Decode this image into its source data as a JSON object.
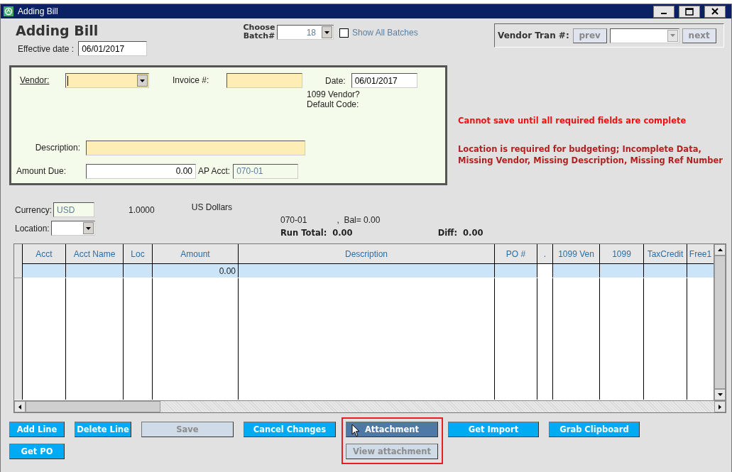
{
  "window": {
    "title": "Adding Bill"
  },
  "heading": "Adding Bill",
  "batch": {
    "label": "Choose Batch#",
    "value": "18",
    "show_all": {
      "label": "Show All Batches",
      "checked": false
    }
  },
  "vendor_tran": {
    "label": "Vendor Tran #:",
    "prev": {
      "label": "prev",
      "disabled": true
    },
    "next": {
      "label": "next",
      "disabled": true
    }
  },
  "effective_date": {
    "label": "Effective date :",
    "value": "06/01/2017"
  },
  "bill": {
    "vendor": {
      "label": "Vendor:",
      "required": true
    },
    "invoice": {
      "label": "Invoice #:",
      "required": true
    },
    "date": {
      "label": "Date:",
      "value": "06/01/2017"
    },
    "vendor_1099": "1099 Vendor?",
    "default_code": "Default Code:",
    "description": {
      "label": "Description:",
      "required": true
    },
    "amount_due": {
      "label": "Amount Due:",
      "value": "0.00"
    },
    "ap_acct": {
      "label": "AP Acct:",
      "value": "070-01",
      "disabled": true
    }
  },
  "messages": [
    {
      "kind": "error",
      "text": "Cannot save until all required fields are complete"
    },
    {
      "kind": "warning",
      "text": "Location is required for budgeting; Incomplete Data,\nMissing Vendor, Missing Description, Missing Ref Number"
    }
  ],
  "currency": {
    "label": "Currency:",
    "code": "USD",
    "rate": "1.0000",
    "name": "US Dollars"
  },
  "location": {
    "label": "Location:"
  },
  "summary": {
    "account": "070-01",
    "balance": ",  Bal= 0.00",
    "run_total_label": "Run Total:",
    "run_total": "0.00",
    "diff_label": "Diff:",
    "diff": "0.00"
  },
  "grid": {
    "columns": [
      "Acct",
      "Acct Name",
      "Loc",
      "Amount",
      "Description",
      "PO #",
      ".",
      "1099 Ven",
      "1099",
      "TaxCredit",
      "Free1"
    ],
    "rows": [
      {
        "selected": true,
        "amount": "0.00"
      }
    ]
  },
  "button_columns": [
    {
      "highlighted": false,
      "buttons": [
        {
          "label": "Add Line",
          "disabled": false,
          "hovered": false
        },
        {
          "label": "Get PO",
          "disabled": false,
          "hovered": false
        }
      ]
    },
    {
      "highlighted": false,
      "buttons": [
        {
          "label": "Delete Line",
          "disabled": false,
          "hovered": false
        }
      ]
    },
    {
      "highlighted": false,
      "buttons": [
        {
          "label": "Save",
          "disabled": true,
          "hovered": false
        }
      ]
    },
    {
      "highlighted": false,
      "buttons": [
        {
          "label": "Cancel Changes",
          "disabled": false,
          "hovered": false
        }
      ]
    },
    {
      "highlighted": true,
      "buttons": [
        {
          "label": "Attachment",
          "disabled": false,
          "hovered": true
        },
        {
          "label": "View attachment",
          "disabled": true,
          "hovered": false
        }
      ]
    },
    {
      "highlighted": false,
      "buttons": [
        {
          "label": "Get Import",
          "disabled": false,
          "hovered": false
        }
      ]
    },
    {
      "highlighted": false,
      "buttons": [
        {
          "label": "Grab Clipboard",
          "disabled": false,
          "hovered": false
        }
      ]
    }
  ]
}
